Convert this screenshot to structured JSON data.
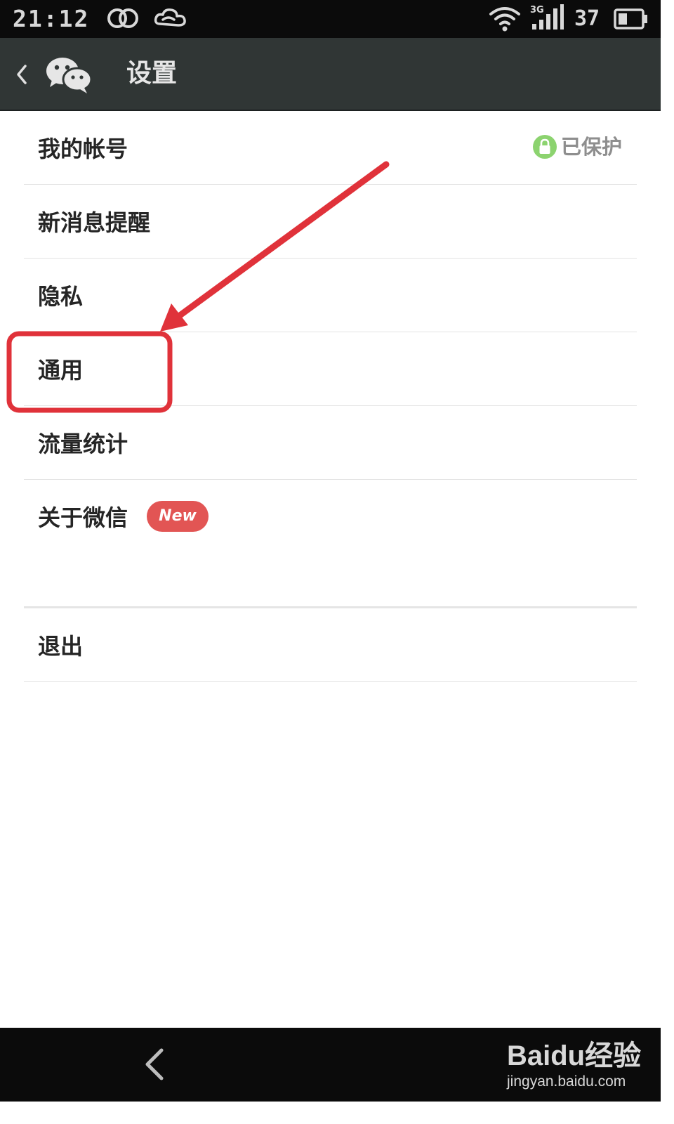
{
  "status_bar": {
    "time": "21:12",
    "network_type": "3G",
    "battery_percent": "37"
  },
  "action_bar": {
    "title": "设置"
  },
  "settings": {
    "items": [
      {
        "label": "我的帐号",
        "status": "已保护"
      },
      {
        "label": "新消息提醒"
      },
      {
        "label": "隐私"
      },
      {
        "label": "通用"
      },
      {
        "label": "流量统计"
      },
      {
        "label": "关于微信",
        "badge": "New"
      }
    ],
    "logout_label": "退出"
  },
  "annotation": {
    "highlighted_item": "通用",
    "color": "#e0323a"
  },
  "watermark": {
    "logo_text": "Baidu经验",
    "url": "jingyan.baidu.com"
  },
  "colors": {
    "status_bar": "#0b0b0b",
    "action_bar": "#303635",
    "lock_badge": "#8cd36f",
    "new_badge": "#e25554",
    "annotation": "#e0323a"
  },
  "icons": {
    "status": [
      "dual-ring-icon",
      "cloud-icon",
      "wifi-icon",
      "signal-icon",
      "battery-icon"
    ],
    "action_bar": [
      "back-chevron-icon",
      "wechat-logo-icon"
    ],
    "nav_bar": [
      "back-arrow-icon"
    ]
  }
}
